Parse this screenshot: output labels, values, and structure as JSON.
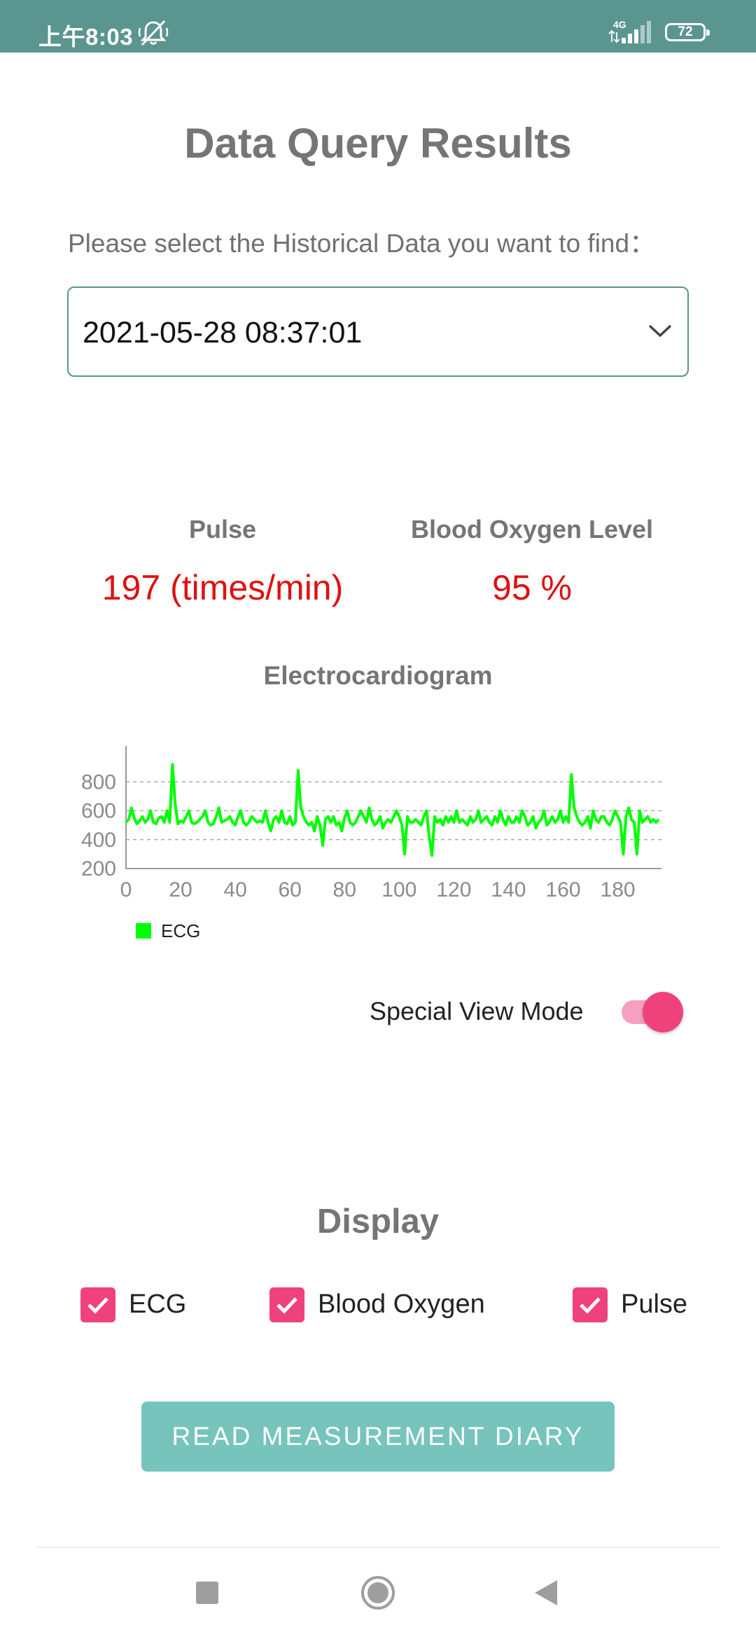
{
  "status_bar": {
    "time": "上午8:03",
    "network": "4G",
    "battery": "72"
  },
  "page": {
    "title": "Data Query Results",
    "prompt": "Please select the Historical Data you want to find："
  },
  "history_select": {
    "selected_value": "2021-05-28 08:37:01"
  },
  "metrics": {
    "pulse_label": "Pulse",
    "pulse_value": "197 (times/min)",
    "oxygen_label": "Blood Oxygen Level",
    "oxygen_value": "95 %"
  },
  "ecg": {
    "title": "Electrocardiogram"
  },
  "chart_data": {
    "type": "line",
    "xlim": [
      0,
      196
    ],
    "ylim": [
      200,
      1000
    ],
    "x_ticks": [
      0,
      20,
      40,
      60,
      80,
      100,
      120,
      140,
      160,
      180
    ],
    "y_ticks": [
      200,
      400,
      600,
      800
    ],
    "grid": "horizontal dashed",
    "legend": "bottom-left",
    "series": [
      {
        "name": "ECG",
        "color": "#00ff00",
        "values": [
          520,
          540,
          620,
          550,
          510,
          530,
          560,
          520,
          540,
          600,
          520,
          510,
          550,
          560,
          520,
          600,
          520,
          920,
          640,
          510,
          530,
          520,
          560,
          600,
          520,
          510,
          520,
          540,
          560,
          600,
          520,
          500,
          510,
          560,
          620,
          520,
          530,
          540,
          560,
          520,
          500,
          560,
          600,
          520,
          500,
          520,
          560,
          540,
          520,
          530,
          520,
          600,
          520,
          460,
          540,
          560,
          520,
          600,
          520,
          510,
          560,
          500,
          520,
          880,
          620,
          560,
          520,
          500,
          520,
          460,
          560,
          500,
          360,
          540,
          560,
          520,
          560,
          500,
          520,
          460,
          550,
          600,
          520,
          500,
          520,
          560,
          600,
          560,
          520,
          620,
          540,
          500,
          520,
          560,
          480,
          520,
          540,
          520,
          560,
          600,
          560,
          500,
          300,
          560,
          520,
          520,
          540,
          520,
          500,
          560,
          600,
          420,
          290,
          560,
          520,
          540,
          500,
          560,
          520,
          560,
          520,
          600,
          520,
          540,
          520,
          500,
          560,
          520,
          540,
          600,
          520,
          540,
          560,
          520,
          500,
          560,
          520,
          600,
          540,
          500,
          560,
          520,
          520,
          560,
          520,
          600,
          560,
          500,
          520,
          560,
          480,
          520,
          540,
          600,
          500,
          520,
          560,
          520,
          540,
          600,
          520,
          560,
          520,
          850,
          620,
          560,
          520,
          500,
          520,
          560,
          480,
          600,
          540,
          520,
          560,
          560,
          520,
          500,
          540,
          600,
          560,
          520,
          300,
          560,
          620,
          540,
          520,
          300,
          600,
          520,
          540,
          560,
          520,
          540,
          520,
          540
        ]
      }
    ]
  },
  "view_mode": {
    "label": "Special View Mode",
    "enabled": true
  },
  "display": {
    "title": "Display",
    "options": [
      {
        "label": "ECG",
        "checked": true
      },
      {
        "label": "Blood Oxygen",
        "checked": true
      },
      {
        "label": "Pulse",
        "checked": true
      }
    ]
  },
  "actions": {
    "read_diary_label": "READ MEASUREMENT DIARY"
  },
  "colors": {
    "status_bar": "#5b958f",
    "accent_pink": "#f0427a",
    "button_teal": "#76c4bc",
    "value_red": "#e01010",
    "ecg_line": "#00ff00"
  },
  "nav_bar": {
    "icons": [
      "recent-apps-icon",
      "home-icon",
      "back-icon"
    ]
  }
}
